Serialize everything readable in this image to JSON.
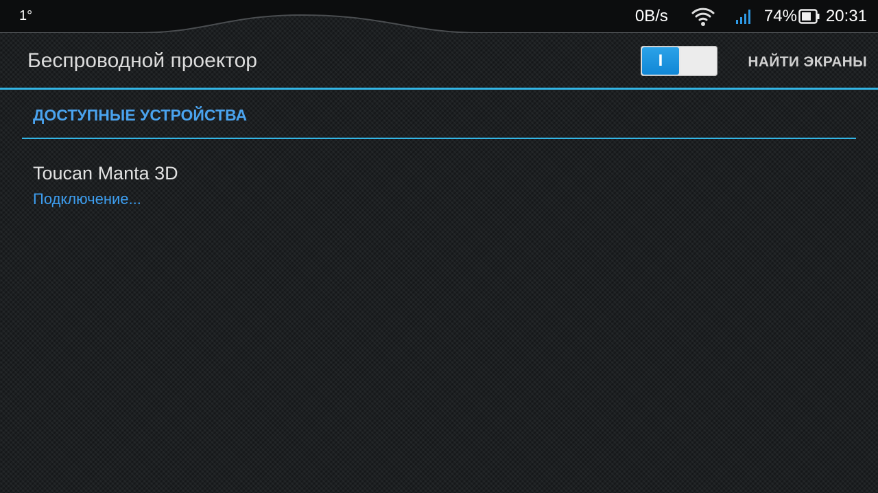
{
  "status_bar": {
    "temperature": "1°",
    "network_speed": "0B/s",
    "battery_percent": "74%",
    "time": "20:31",
    "icons": [
      "wifi-icon",
      "cell-signal-icon",
      "battery-icon"
    ]
  },
  "action_bar": {
    "title": "Беспроводной проектор",
    "toggle_label": "I",
    "toggle_state": "on",
    "find_screens": "НАЙТИ ЭКРАНЫ"
  },
  "section": {
    "header": "ДОСТУПНЫЕ УСТРОЙСТВА"
  },
  "devices": [
    {
      "name": "Toucan Manta 3D",
      "status": "Подключение..."
    }
  ],
  "colors": {
    "accent": "#33b5e5",
    "section_header": "#4aa3ee",
    "device_status": "#3d9ef0",
    "toggle_on": "#1b93df",
    "background": "#1c1f21"
  }
}
